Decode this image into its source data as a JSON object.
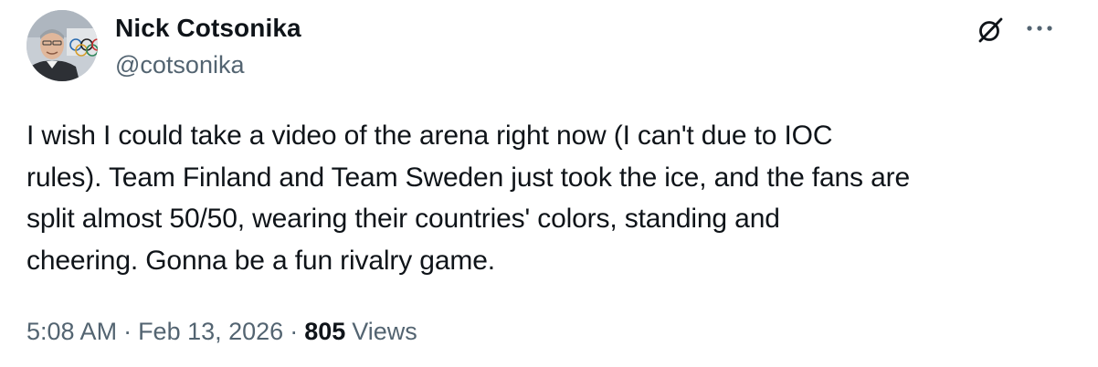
{
  "author": {
    "name": "Nick Cotsonika",
    "handle": "@cotsonika"
  },
  "tweet": {
    "text": "I wish I could take a video of the arena right now (I can't due to IOC\nrules). Team Finland and Team Sweden just took the ice, and the fans are\nsplit almost 50/50, wearing their countries' colors, standing and\ncheering. Gonna be a fun rivalry game."
  },
  "meta": {
    "time": "5:08 AM",
    "separator": "·",
    "date": "Feb 13, 2026",
    "views_count": "805",
    "views_label": "Views"
  },
  "icons": {
    "grok": "grok-icon",
    "more": "more-horizontal-icon"
  },
  "colors": {
    "primary_text": "#0f1419",
    "secondary_text": "#536471",
    "background": "#ffffff"
  }
}
